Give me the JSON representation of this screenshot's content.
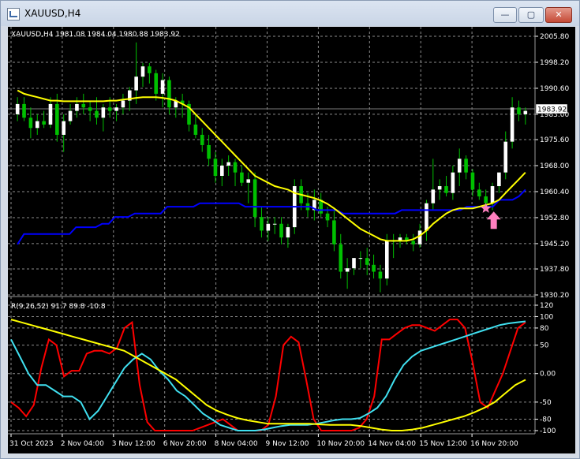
{
  "window": {
    "title": "XAUUSD,H4",
    "buttons": {
      "minimize": "—",
      "maximize": "▢",
      "close": "✕"
    }
  },
  "colors": {
    "background": "#000000",
    "grid": "#8c8c8c",
    "axis_text": "#ffffff",
    "bull_candle": "#ffffff",
    "bear_candle": "#00c000",
    "ma_yellow": "#ffff00",
    "ma_blue": "#0000ff",
    "osc_red": "#ff0000",
    "osc_cyan": "#40e0f0",
    "osc_yellow": "#ffff00",
    "marker": "#ff7fbf"
  },
  "chart_data": [
    {
      "type": "candlestick",
      "header": "XAUUSD,H4  1981.08 1984.04 1980.88 1983.92",
      "current_price": "1983.92",
      "price_axis": [
        "2005.80",
        "1998.20",
        "1990.60",
        "1983.00",
        "1975.60",
        "1968.00",
        "1960.40",
        "1952.80",
        "1945.20",
        "1937.80",
        "1930.20"
      ],
      "ylim": [
        1930.2,
        2005.8
      ],
      "time_axis": [
        "31 Oct 2023",
        "2 Nov 04:00",
        "3 Nov 12:00",
        "6 Nov 20:00",
        "8 Nov 04:00",
        "9 Nov 12:00",
        "10 Nov 20:00",
        "14 Nov 04:00",
        "15 Nov 12:00",
        "16 Nov 20:00"
      ],
      "candles": [
        [
          1983,
          1988,
          1981,
          1986
        ],
        [
          1986,
          1988,
          1981,
          1982
        ],
        [
          1982,
          1985,
          1976,
          1979
        ],
        [
          1979,
          1983,
          1977,
          1981
        ],
        [
          1981,
          1984,
          1979,
          1980
        ],
        [
          1980,
          1988,
          1979,
          1986
        ],
        [
          1986,
          1989,
          1975,
          1977
        ],
        [
          1977,
          1983,
          1972,
          1981
        ],
        [
          1981,
          1986,
          1980,
          1984
        ],
        [
          1984,
          1988,
          1982,
          1986
        ],
        [
          1986,
          1989,
          1983,
          1985
        ],
        [
          1985,
          1987,
          1981,
          1984
        ],
        [
          1984,
          1988,
          1980,
          1982
        ],
        [
          1982,
          1986,
          1978,
          1985
        ],
        [
          1985,
          1988,
          1982,
          1984
        ],
        [
          1984,
          1986,
          1981,
          1985
        ],
        [
          1985,
          1989,
          1983,
          1987
        ],
        [
          1987,
          1991,
          1984,
          1990
        ],
        [
          1990,
          2004,
          1986,
          1994
        ],
        [
          1994,
          1998,
          1991,
          1997
        ],
        [
          1997,
          1998,
          1992,
          1995
        ],
        [
          1995,
          1996,
          1987,
          1989
        ],
        [
          1989,
          1995,
          1985,
          1993
        ],
        [
          1993,
          1994,
          1983,
          1985
        ],
        [
          1985,
          1988,
          1982,
          1987
        ],
        [
          1987,
          1989,
          1982,
          1986
        ],
        [
          1986,
          1987,
          1978,
          1980
        ],
        [
          1980,
          1983,
          1976,
          1977
        ],
        [
          1977,
          1979,
          1972,
          1974
        ],
        [
          1974,
          1977,
          1968,
          1970
        ],
        [
          1970,
          1972,
          1963,
          1965
        ],
        [
          1965,
          1970,
          1962,
          1968
        ],
        [
          1968,
          1971,
          1965,
          1969
        ],
        [
          1969,
          1970,
          1962,
          1966
        ],
        [
          1966,
          1968,
          1962,
          1963
        ],
        [
          1963,
          1966,
          1957,
          1964
        ],
        [
          1964,
          1966,
          1950,
          1953
        ],
        [
          1953,
          1956,
          1947,
          1949
        ],
        [
          1949,
          1953,
          1946,
          1951
        ],
        [
          1951,
          1953,
          1948,
          1951
        ],
        [
          1951,
          1953,
          1945,
          1947
        ],
        [
          1947,
          1951,
          1944,
          1950
        ],
        [
          1950,
          1964,
          1948,
          1962
        ],
        [
          1962,
          1964,
          1955,
          1957
        ],
        [
          1957,
          1960,
          1953,
          1955
        ],
        [
          1955,
          1961,
          1952,
          1958
        ],
        [
          1958,
          1960,
          1953,
          1954
        ],
        [
          1954,
          1956,
          1950,
          1952
        ],
        [
          1952,
          1955,
          1943,
          1945
        ],
        [
          1945,
          1948,
          1935,
          1937
        ],
        [
          1937,
          1941,
          1932,
          1938
        ],
        [
          1938,
          1941,
          1936,
          1941
        ],
        [
          1941,
          1943,
          1938,
          1941
        ],
        [
          1941,
          1944,
          1936,
          1939
        ],
        [
          1939,
          1942,
          1935,
          1937
        ],
        [
          1937,
          1939,
          1931,
          1935
        ],
        [
          1935,
          1948,
          1933,
          1946
        ],
        [
          1946,
          1948,
          1941,
          1946
        ],
        [
          1946,
          1948,
          1944,
          1947
        ],
        [
          1947,
          1948,
          1945,
          1946
        ],
        [
          1946,
          1948,
          1943,
          1945
        ],
        [
          1945,
          1951,
          1944,
          1949
        ],
        [
          1949,
          1958,
          1946,
          1957
        ],
        [
          1957,
          1970,
          1955,
          1961
        ],
        [
          1961,
          1964,
          1958,
          1962
        ],
        [
          1962,
          1965,
          1959,
          1960
        ],
        [
          1960,
          1968,
          1958,
          1966
        ],
        [
          1966,
          1973,
          1962,
          1970
        ],
        [
          1970,
          1971,
          1964,
          1966
        ],
        [
          1966,
          1967,
          1959,
          1961
        ],
        [
          1961,
          1963,
          1958,
          1959
        ],
        [
          1959,
          1961,
          1955,
          1957
        ],
        [
          1957,
          1963,
          1955,
          1962
        ],
        [
          1962,
          1966,
          1960,
          1966
        ],
        [
          1966,
          1978,
          1964,
          1975
        ],
        [
          1975,
          1988,
          1973,
          1985
        ],
        [
          1985,
          1987,
          1981,
          1983
        ],
        [
          1983,
          1985,
          1980,
          1984
        ]
      ],
      "ma_yellow": [
        1990,
        1989,
        1988.5,
        1988,
        1987.5,
        1987,
        1987,
        1986.8,
        1986.8,
        1986.8,
        1986.8,
        1986.8,
        1986.8,
        1986.8,
        1987,
        1987,
        1987.3,
        1987.5,
        1987.8,
        1988,
        1988,
        1988,
        1987.8,
        1987.5,
        1987,
        1986,
        1985,
        1983,
        1981,
        1979,
        1977,
        1975,
        1973,
        1971,
        1969,
        1967,
        1965,
        1964,
        1963,
        1962,
        1961.5,
        1961,
        1960,
        1959.5,
        1959,
        1958.5,
        1957.8,
        1956.8,
        1955.5,
        1954,
        1952.5,
        1951,
        1949.5,
        1948.5,
        1947.5,
        1946.5,
        1946,
        1946,
        1946,
        1946,
        1946.5,
        1947.5,
        1949,
        1951,
        1952.5,
        1954,
        1955,
        1955.5,
        1955.5,
        1955.5,
        1956,
        1956.5,
        1957,
        1958,
        1960,
        1962,
        1964,
        1966
      ],
      "ma_blue": [
        1945,
        1948,
        1948,
        1948,
        1948,
        1948,
        1948,
        1948,
        1948,
        1950,
        1950,
        1950,
        1950,
        1951,
        1951,
        1953,
        1953,
        1953,
        1954,
        1954,
        1954,
        1954,
        1954,
        1956,
        1956,
        1956,
        1956,
        1956,
        1957,
        1957,
        1957,
        1957,
        1957,
        1957,
        1957,
        1956,
        1956,
        1956,
        1956,
        1956,
        1956,
        1956,
        1956,
        1956,
        1956,
        1956,
        1955,
        1955,
        1955,
        1955,
        1954,
        1954,
        1954,
        1954,
        1954,
        1954,
        1954,
        1954,
        1954,
        1955,
        1955,
        1955,
        1955,
        1955,
        1955,
        1955,
        1955,
        1955,
        1955,
        1956,
        1956,
        1956,
        1956,
        1956,
        1958,
        1958,
        1958,
        1959,
        1961
      ],
      "marker_price": 1955.5,
      "marker_index": 71
    },
    {
      "type": "line",
      "header": "R(9,26,52) 91.7 89.8 -10.8",
      "axis": [
        "120",
        "100",
        "80",
        "50",
        "0.00",
        "-50",
        "-80",
        "-100"
      ],
      "ylim": [
        -100,
        120
      ],
      "series": [
        {
          "color": "red",
          "values": [
            -50,
            -60,
            -75,
            -55,
            10,
            60,
            50,
            -5,
            5,
            5,
            35,
            40,
            40,
            35,
            45,
            80,
            90,
            -20,
            -85,
            -100,
            -100,
            -100,
            -100,
            -100,
            -100,
            -95,
            -90,
            -85,
            -80,
            -90,
            -100,
            -100,
            -100,
            -100,
            -90,
            -40,
            50,
            65,
            55,
            -10,
            -80,
            -100,
            -100,
            -100,
            -100,
            -100,
            -95,
            -80,
            -40,
            60,
            60,
            70,
            80,
            85,
            85,
            80,
            75,
            85,
            95,
            95,
            80,
            20,
            -50,
            -60,
            -30,
            0,
            40,
            80,
            90
          ]
        },
        {
          "color": "cyan",
          "values": [
            60,
            30,
            0,
            -20,
            -20,
            -30,
            -40,
            -40,
            -50,
            -80,
            -65,
            -40,
            -15,
            10,
            25,
            35,
            25,
            5,
            -10,
            -30,
            -40,
            -55,
            -70,
            -80,
            -90,
            -95,
            -100,
            -100,
            -100,
            -98,
            -95,
            -92,
            -90,
            -90,
            -90,
            -88,
            -85,
            -82,
            -80,
            -80,
            -78,
            -70,
            -60,
            -40,
            -10,
            15,
            30,
            40,
            45,
            50,
            55,
            60,
            65,
            70,
            75,
            80,
            85,
            88,
            90,
            91.7
          ]
        },
        {
          "color": "yellow",
          "values": [
            95,
            90,
            85,
            80,
            75,
            70,
            65,
            60,
            55,
            50,
            45,
            40,
            30,
            20,
            10,
            0,
            -10,
            -25,
            -40,
            -55,
            -65,
            -72,
            -78,
            -82,
            -85,
            -88,
            -88,
            -88,
            -88,
            -88,
            -89,
            -90,
            -90,
            -90,
            -92,
            -95,
            -98,
            -100,
            -100,
            -98,
            -95,
            -90,
            -85,
            -80,
            -75,
            -68,
            -60,
            -50,
            -35,
            -20,
            -10.8
          ]
        }
      ]
    }
  ]
}
